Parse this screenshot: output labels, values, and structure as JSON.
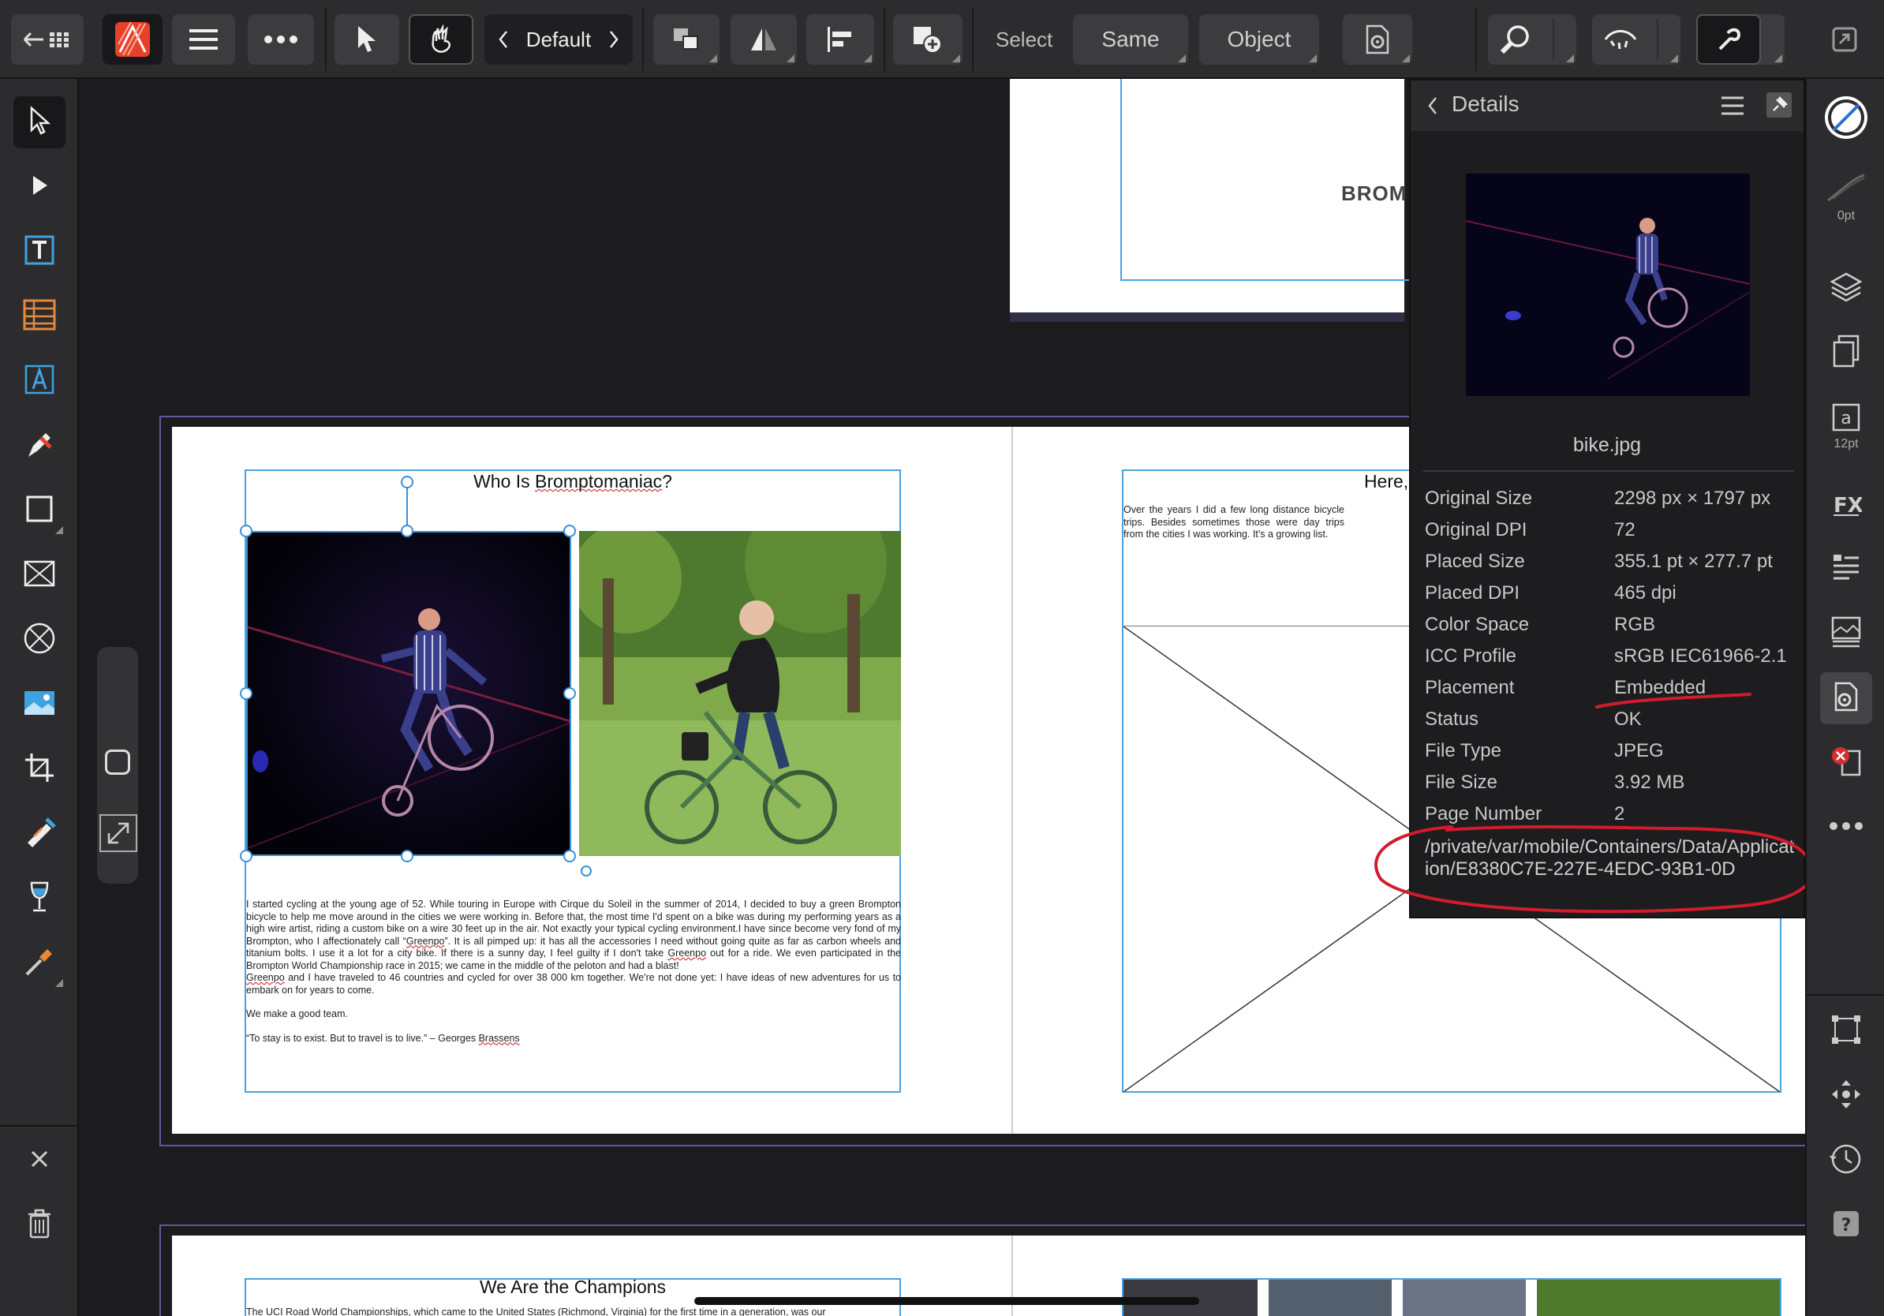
{
  "toolbar": {
    "persona_label": "Default",
    "select_label": "Select",
    "same_label": "Same",
    "object_label": "Object",
    "icons": [
      "back-grid-icon",
      "app-logo-icon",
      "menu-icon",
      "more-icon",
      "move-tool-icon",
      "hand-tool-icon",
      "chevron-left-icon",
      "chevron-right-icon",
      "arrange-icon",
      "flip-icon",
      "align-icon",
      "add-object-icon",
      "select-settings-icon",
      "zoom-icon",
      "view-icon",
      "snapping-icon",
      "fullscreen-icon"
    ]
  },
  "details": {
    "title": "Details",
    "filename": "bike.jpg",
    "rows": [
      {
        "key": "Original Size",
        "value": "2298 px × 1797 px"
      },
      {
        "key": "Original DPI",
        "value": "72"
      },
      {
        "key": "Placed Size",
        "value": "355.1 pt × 277.7 pt"
      },
      {
        "key": "Placed DPI",
        "value": "465 dpi"
      },
      {
        "key": "Color Space",
        "value": "RGB"
      },
      {
        "key": "ICC Profile",
        "value": "sRGB IEC61966-2.1"
      },
      {
        "key": "Placement",
        "value": "Embedded"
      },
      {
        "key": "Status",
        "value": "OK"
      },
      {
        "key": "File Type",
        "value": "JPEG"
      },
      {
        "key": "File Size",
        "value": "3.92 MB"
      },
      {
        "key": "Page Number",
        "value": "2"
      }
    ],
    "filepath": "/private/var/mobile/Containers/Data/Application/E8380C7E-227E-4EDC-93B1-0D",
    "annotation_color": "#d21c2c"
  },
  "rightbar": {
    "stroke_label": "0pt",
    "text_size_label": "12pt"
  },
  "document": {
    "top_fragment": "BROM",
    "page2_title": "Who Is Bromptomaniac?",
    "page2_body_1": "I started cycling at the young age of 52. While touring in Europe with Cirque du Soleil in the summer of 2014, I decided to buy a green Brompton bicycle to help me move around in the cities we were working in. Before that, the most time I'd spent on a bike was during my performing years as a high wire artist, riding a custom bike on a wire 30 feet up in the air. Not exactly your typical cycling environment.I have since become very fond of my Brompton, who I affectionately call “Greenpo”. It is all pimped up: it has all the accessories I need without going quite as far as carbon wheels and titanium bolts. I use it a lot for a city bike. If there is a sunny day, I feel guilty if I don't take Greenpo out for a ride. We even participated in the Brompton World Championship race in 2015; we came in the middle of the peloton and had a blast!",
    "page2_body_2": "Greenpo and I have traveled to 46 countries and cycled for over 38 000 km together. We're not done yet: I have ideas of new adventures for us to embark on for years to come.",
    "page2_body_3": "We make a good team.",
    "page2_quote": "“To stay is to exist. But to travel is to live.” – Georges Brassens",
    "page3_title": "Here, Th",
    "page3_body": "Over the years I did a few long distance bicycle trips. Besides sometimes those were day trips from the cities I was working. It's a growing list.",
    "page4_title": "We Are the Champions",
    "page4_body": "The UCI Road World Championships, which came to the United States (Richmond, Virginia) for the first time in a generation, was our"
  },
  "colors": {
    "accent": "#4aa3df",
    "spread_border": "#5b5b9a",
    "panel_bg": "#2c2c2e",
    "canvas_bg": "#1c1c1e"
  }
}
